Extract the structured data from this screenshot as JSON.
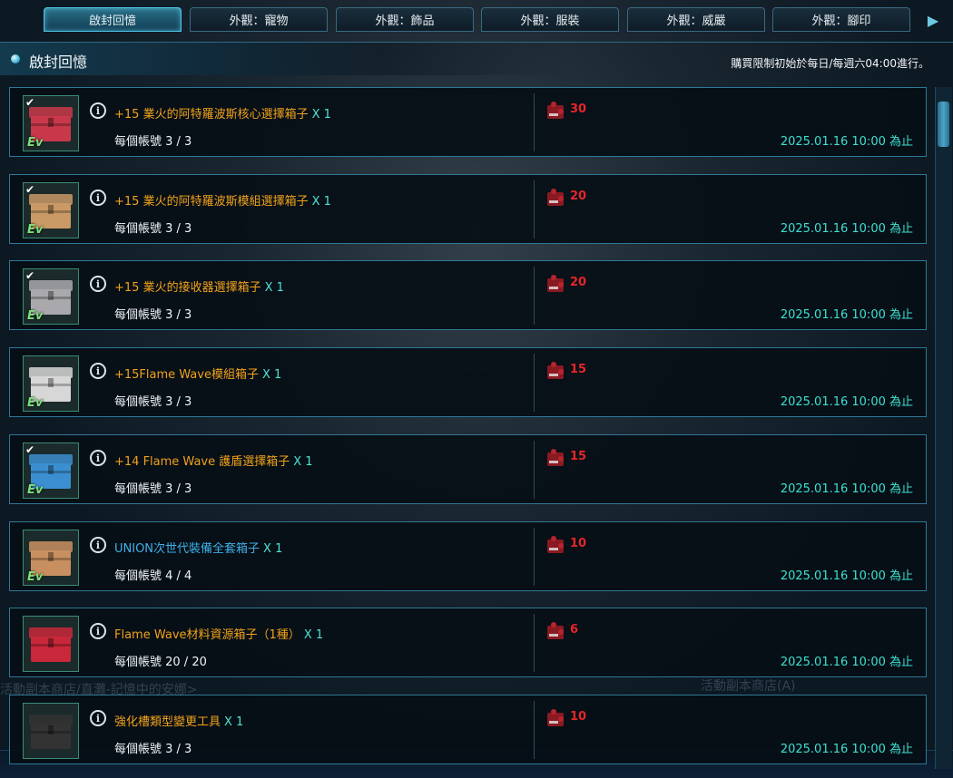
{
  "tabs": [
    {
      "label": "啟封回憶",
      "active": true
    },
    {
      "label": "外觀：寵物",
      "active": false
    },
    {
      "label": "外觀：飾品",
      "active": false
    },
    {
      "label": "外觀：服裝",
      "active": false
    },
    {
      "label": "外觀：威嚴",
      "active": false
    },
    {
      "label": "外觀：腳印",
      "active": false
    }
  ],
  "header": {
    "title": "啟封回憶",
    "note": "購買限制初始於每日/每週六04:00進行。"
  },
  "background_text": {
    "left": "活動副本商店/直灘-記憶中的安娜>",
    "right": "活動副本商店(A)"
  },
  "items": [
    {
      "name": "+15 業火的阿特羅波斯核心選擇箱子",
      "qty": "X 1",
      "limit": "每個帳號 3 / 3",
      "cost": "30",
      "deadline": "2025.01.16 10:00 為止",
      "ev": "Ev",
      "box_color": "#c8384a",
      "checked": true,
      "name_color": "orange"
    },
    {
      "name": "+15 業火的阿特羅波斯模組選擇箱子",
      "qty": "X 1",
      "limit": "每個帳號 3 / 3",
      "cost": "20",
      "deadline": "2025.01.16 10:00 為止",
      "ev": "Ev",
      "box_color": "#c99a66",
      "checked": true,
      "name_color": "orange"
    },
    {
      "name": "+15 業火的接收器選擇箱子",
      "qty": "X 1",
      "limit": "每個帳號 3 / 3",
      "cost": "20",
      "deadline": "2025.01.16 10:00 為止",
      "ev": "Ev",
      "box_color": "#a9a9ad",
      "checked": true,
      "name_color": "orange"
    },
    {
      "name": "+15Flame Wave模組箱子",
      "qty": "X 1",
      "limit": "每個帳號 3 / 3",
      "cost": "15",
      "deadline": "2025.01.16 10:00 為止",
      "ev": "Ev",
      "box_color": "#d7d7d7",
      "checked": false,
      "name_color": "orange"
    },
    {
      "name": "+14 Flame Wave 護盾選擇箱子",
      "qty": "X 1",
      "limit": "每個帳號 3 / 3",
      "cost": "15",
      "deadline": "2025.01.16 10:00 為止",
      "ev": "Ev",
      "box_color": "#3b8fd0",
      "checked": true,
      "name_color": "orange"
    },
    {
      "name": "UNION次世代裝備全套箱子",
      "qty": "X 1",
      "limit": "每個帳號 4 / 4",
      "cost": "10",
      "deadline": "2025.01.16 10:00 為止",
      "ev": "Ev",
      "box_color": "#c89060",
      "checked": false,
      "name_color": "blue"
    },
    {
      "name": "Flame Wave材料資源箱子（1種）",
      "qty": "X 1",
      "limit": "每個帳號 20 / 20",
      "cost": "6",
      "deadline": "2025.01.16 10:00 為止",
      "ev": "",
      "box_color": "#c8283a",
      "checked": false,
      "name_color": "orange"
    },
    {
      "name": "強化槽類型變更工具",
      "qty": "X 1",
      "limit": "每個帳號 3 / 3",
      "cost": "10",
      "deadline": "2025.01.16 10:00 為止",
      "ev": "",
      "box_color": "#333333",
      "checked": false,
      "name_color": "orange"
    }
  ],
  "colors": {
    "accent": "#4ec8ea",
    "item_name": "#f0a21a",
    "item_name_blue": "#3fb0e8",
    "qty": "#4fe3d2",
    "cost": "#e5262a",
    "deadline": "#3de0d0"
  }
}
